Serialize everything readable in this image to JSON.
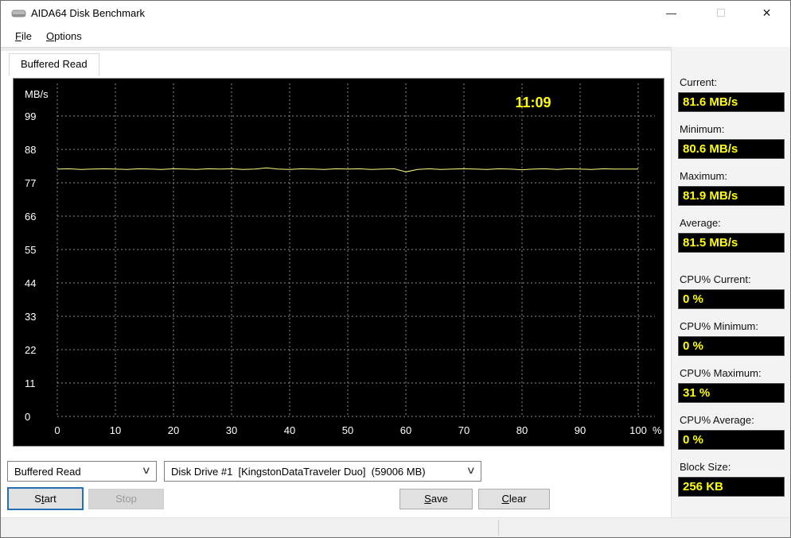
{
  "window": {
    "title": "AIDA64 Disk Benchmark"
  },
  "icons": {
    "app": "disk-icon",
    "minimize_glyph": "—",
    "close_glyph": "✕",
    "chevron_glyph": "∨"
  },
  "menu": {
    "items": [
      {
        "label": "File"
      },
      {
        "label": "Options"
      }
    ]
  },
  "tabs": [
    {
      "label": "Buffered Read"
    }
  ],
  "stats": [
    {
      "label": "Current:",
      "value": "81.6 MB/s"
    },
    {
      "label": "Minimum:",
      "value": "80.6 MB/s"
    },
    {
      "label": "Maximum:",
      "value": "81.9 MB/s"
    },
    {
      "label": "Average:",
      "value": "81.5 MB/s"
    },
    {
      "label": "CPU% Current:",
      "value": "0 %"
    },
    {
      "label": "CPU% Minimum:",
      "value": "0 %"
    },
    {
      "label": "CPU% Maximum:",
      "value": "31 %"
    },
    {
      "label": "CPU% Average:",
      "value": "0 %"
    },
    {
      "label": "Block Size:",
      "value": "256 KB"
    }
  ],
  "controls": {
    "benchmark_select": "Buffered Read",
    "drive_select": "Disk Drive #1  [KingstonDataTraveler Duo]  (59006 MB)",
    "start_label": "Start",
    "stop_label": "Stop",
    "save_label": "Save",
    "clear_label": "Clear"
  },
  "chart_data": {
    "type": "line",
    "title": "Buffered Read benchmark trace",
    "unit": "MB/s",
    "x_unit": "%",
    "time_label": "11:09",
    "x_ticks": [
      0,
      10,
      20,
      30,
      40,
      50,
      60,
      70,
      80,
      90,
      100
    ],
    "y_ticks": [
      99,
      88,
      77,
      66,
      55,
      44,
      33,
      22,
      11,
      0
    ],
    "ylim": [
      0,
      110
    ],
    "xlim": [
      0,
      100
    ],
    "grid": "dashed",
    "x_percent_step": 2,
    "series": [
      {
        "name": "Buffered Read",
        "values": [
          81.5,
          81.6,
          81.4,
          81.5,
          81.6,
          81.5,
          81.4,
          81.6,
          81.5,
          81.4,
          81.6,
          81.5,
          81.4,
          81.6,
          81.5,
          81.6,
          81.4,
          81.5,
          81.9,
          81.5,
          81.4,
          81.6,
          81.5,
          81.4,
          81.6,
          81.5,
          81.6,
          81.4,
          81.5,
          81.6,
          80.6,
          81.4,
          81.6,
          81.4,
          81.5,
          81.6,
          81.5,
          81.4,
          81.6,
          81.5,
          81.3,
          81.5,
          81.6,
          81.4,
          81.6,
          81.5,
          81.4,
          81.6,
          81.5,
          81.5,
          81.5
        ]
      }
    ],
    "colors": {
      "bg": "#000000",
      "grid": "#8c8c8c",
      "line": "#ffff80",
      "text": "#ffffff",
      "accent": "#ffff00"
    }
  }
}
